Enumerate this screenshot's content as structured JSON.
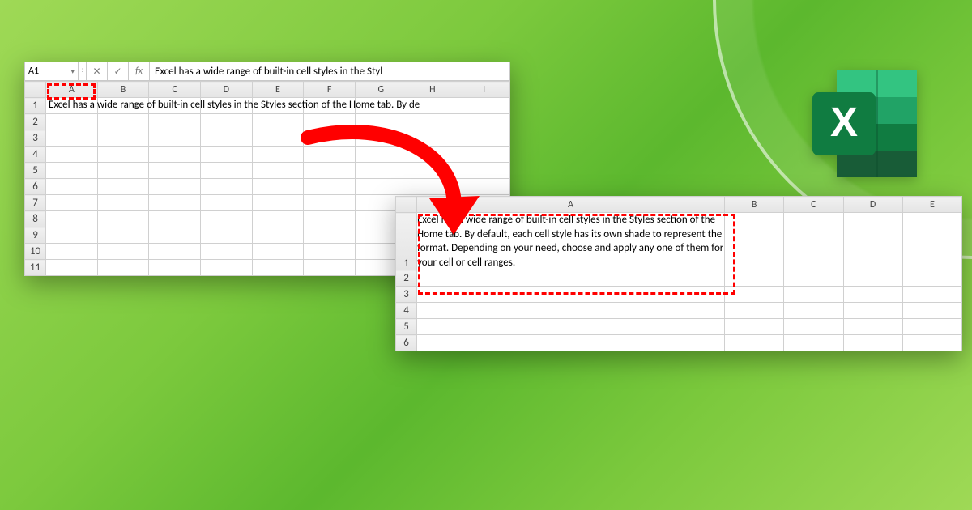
{
  "colors": {
    "accent_red": "#ff0000",
    "excel_green_dark": "#185c37",
    "excel_green_mid": "#21a366",
    "excel_green_light": "#33c481"
  },
  "excel_logo_letter": "X",
  "sheet1": {
    "namebox": "A1",
    "formula_text": "Excel has a wide range of built-in cell styles in the Styl",
    "col_headers": [
      "A",
      "B",
      "C",
      "D",
      "E",
      "F",
      "G",
      "H",
      "I"
    ],
    "row_headers": [
      "1",
      "2",
      "3",
      "4",
      "5",
      "6",
      "7",
      "8",
      "9",
      "10",
      "11"
    ],
    "cell_A1": "Excel has a wide range of built-in cell styles in the Styles section of the Home tab. By de"
  },
  "sheet2": {
    "col_headers": [
      "A",
      "B",
      "C",
      "D",
      "E"
    ],
    "col_A_width": 380,
    "row_headers": [
      "1",
      "2",
      "3",
      "4",
      "5",
      "6"
    ],
    "cell_A1": "Excel has a wide range of built-in cell styles in the Styles section of the Home tab. By default, each cell style has its own shade to represent the format. Depending on your need, choose and apply any one of them for your cell or cell ranges."
  },
  "icons": {
    "dropdown": "▾",
    "separator": "⋮",
    "cancel": "✕",
    "enter": "✓",
    "fx": "fx"
  }
}
